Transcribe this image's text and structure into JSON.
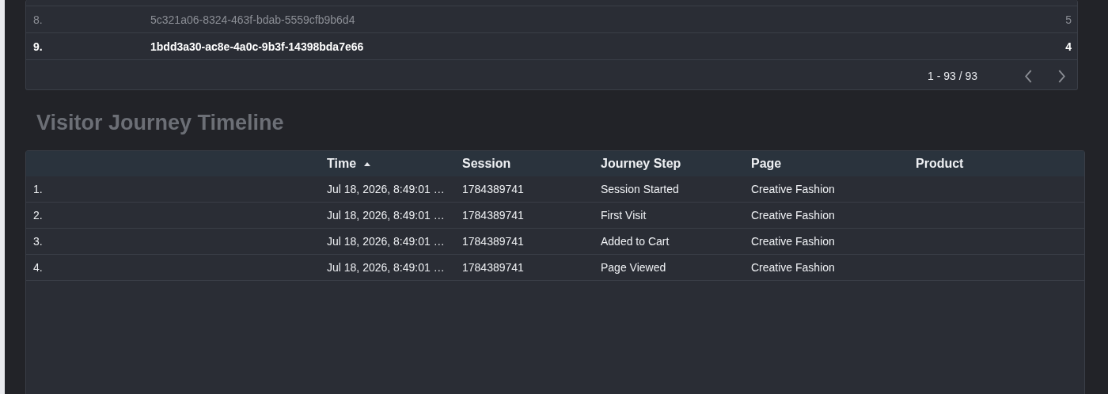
{
  "top_table": {
    "rows": [
      {
        "index": "8.",
        "id": "5c321a06-8324-463f-bdab-5559cfb9b6d4",
        "count": "5",
        "selected": false
      },
      {
        "index": "9.",
        "id": "1bdd3a30-ac8e-4a0c-9b3f-14398bda7e66",
        "count": "4",
        "selected": true
      }
    ],
    "pagination": "1 - 93 / 93"
  },
  "timeline": {
    "title": "Visitor Journey Timeline",
    "columns": [
      {
        "sorted": false
      },
      {
        "label": "Time",
        "sorted": true
      },
      {
        "label": "Session",
        "sorted": false
      },
      {
        "label": "Journey Step",
        "sorted": false
      },
      {
        "label": "Page",
        "sorted": false
      },
      {
        "label": "Product",
        "sorted": false
      }
    ],
    "rows": [
      [
        "1.",
        "Jul 18, 2026, 8:49:01 …",
        "1784389741",
        "Session Started",
        "Creative Fashion"
      ],
      [
        "2.",
        "Jul 18, 2026, 8:49:01 …",
        "1784389741",
        "First Visit",
        "Creative Fashion"
      ],
      [
        "3.",
        "Jul 18, 2026, 8:49:01 …",
        "1784389741",
        "Added to Cart",
        "Creative Fashion"
      ],
      [
        "4.",
        "Jul 18, 2026, 8:49:01 …",
        "1784389741",
        "Page Viewed",
        "Creative Fashion"
      ]
    ]
  }
}
